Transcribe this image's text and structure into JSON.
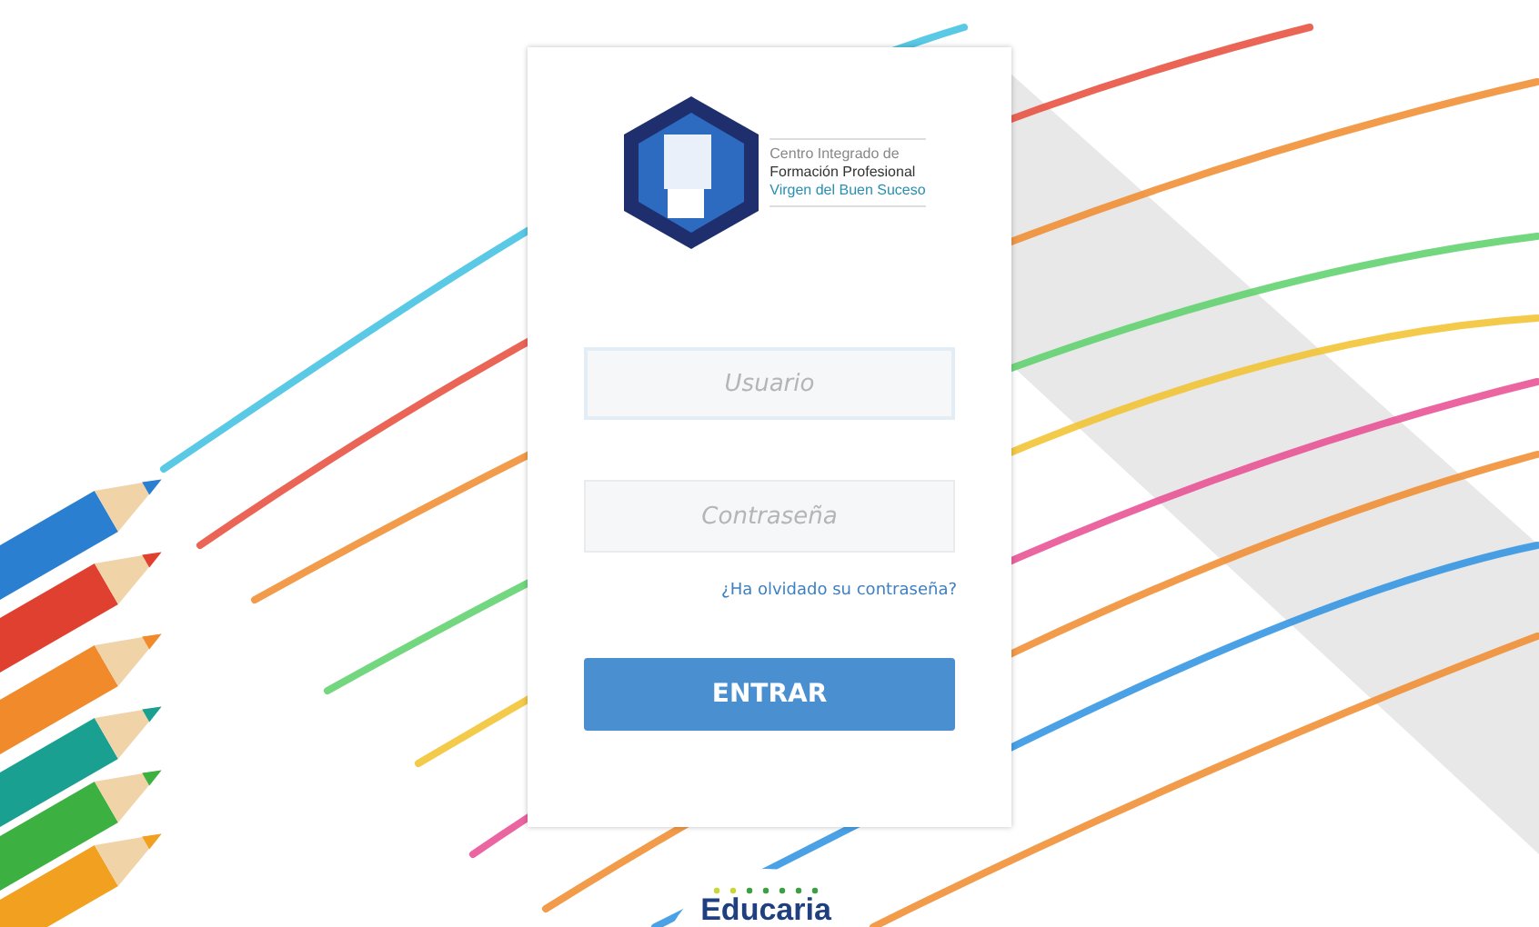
{
  "logo": {
    "lines": [
      "Centro Integrado de",
      "Formación Profesional",
      "Virgen del Buen Suceso"
    ]
  },
  "fields": [
    {
      "placeholder": "Usuario",
      "focused": true
    },
    {
      "placeholder": "Contraseña",
      "focused": false
    }
  ],
  "forgot_link": "¿Ha olvidado su contraseña?",
  "submit_button": "ENTRAR",
  "footer_logo": {
    "name": "Educaria"
  }
}
